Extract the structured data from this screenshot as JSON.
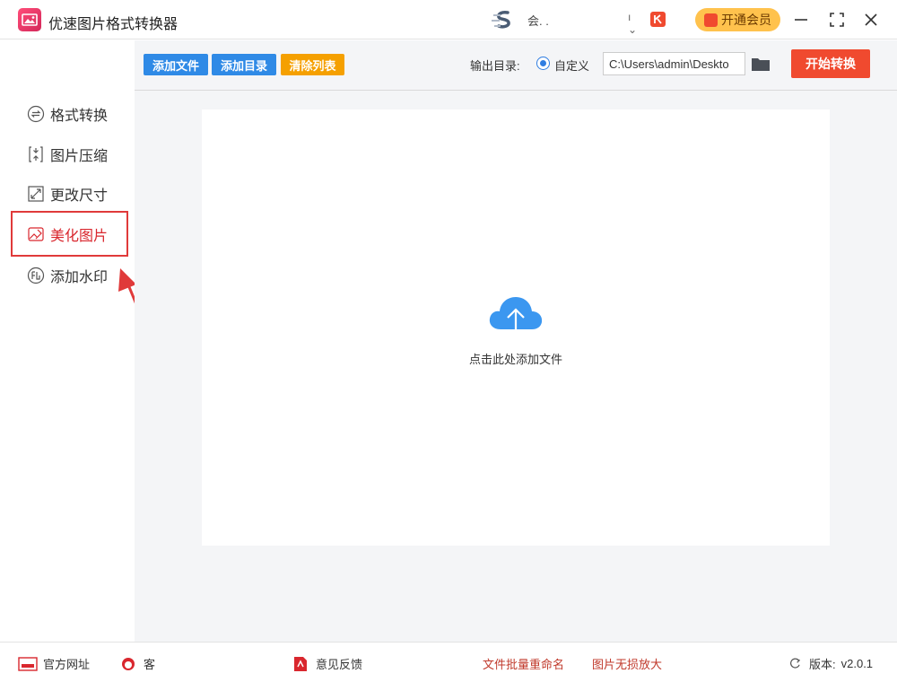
{
  "app": {
    "title": "优速图片格式转换器"
  },
  "user": {
    "name": "会.  ."
  },
  "header": {
    "vip_label": "开通会员"
  },
  "sidebar": {
    "items": [
      {
        "label": "格式转换"
      },
      {
        "label": "图片压缩"
      },
      {
        "label": "更改尺寸"
      },
      {
        "label": "美化图片"
      },
      {
        "label": "添加水印"
      }
    ]
  },
  "toolbar": {
    "add_file": "添加文件",
    "add_dir": "添加目录",
    "clear_list": "清除列表",
    "output_label": "输出目录:",
    "radio_label": "自定义",
    "output_path": "C:\\Users\\admin\\Deskto",
    "start": "开始转换"
  },
  "dropzone": {
    "hint": "点击此处添加文件"
  },
  "footer": {
    "site": "官方网址",
    "service": "客",
    "feedback": "意见反馈",
    "rename": "文件批量重命名",
    "enlarge": "图片无损放大",
    "version_label": "版本:",
    "version": "v2.0.1"
  },
  "colors": {
    "accent_blue": "#2f8ae6",
    "accent_orange": "#f5a000",
    "accent_red": "#f04a2f",
    "vip_yellow": "#ffc24d",
    "highlight_red": "#e03a3a"
  }
}
